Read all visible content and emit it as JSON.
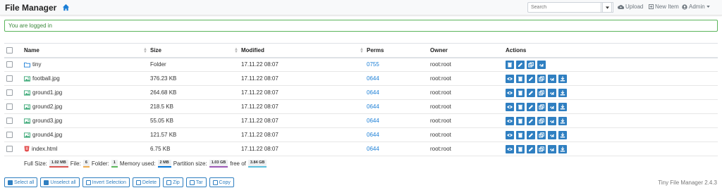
{
  "app": {
    "title": "File Manager",
    "version": "Tiny File Manager 2.4.3"
  },
  "nav": {
    "search_placeholder": "Search",
    "upload": "Upload",
    "new_item": "New Item",
    "admin": "Admin"
  },
  "alert": {
    "message": "You are logged in"
  },
  "table": {
    "headers": {
      "name": "Name",
      "size": "Size",
      "modified": "Modified",
      "perms": "Perms",
      "owner": "Owner",
      "actions": "Actions"
    },
    "rows": [
      {
        "name": "tiny",
        "type": "folder",
        "size": "Folder",
        "modified": "17.11.22 08:07",
        "perms": "0755",
        "owner": "root:root",
        "actions": [
          "delete",
          "rename",
          "copy",
          "link"
        ]
      },
      {
        "name": "football.jpg",
        "type": "image",
        "size": "376.23 KB",
        "modified": "17.11.22 08:07",
        "perms": "0644",
        "owner": "root:root",
        "actions": [
          "view",
          "delete",
          "rename",
          "copy",
          "link",
          "download"
        ]
      },
      {
        "name": "ground1.jpg",
        "type": "image",
        "size": "264.68 KB",
        "modified": "17.11.22 08:07",
        "perms": "0644",
        "owner": "root:root",
        "actions": [
          "view",
          "delete",
          "rename",
          "copy",
          "link",
          "download"
        ]
      },
      {
        "name": "ground2.jpg",
        "type": "image",
        "size": "218.5 KB",
        "modified": "17.11.22 08:07",
        "perms": "0644",
        "owner": "root:root",
        "actions": [
          "view",
          "delete",
          "rename",
          "copy",
          "link",
          "download"
        ]
      },
      {
        "name": "ground3.jpg",
        "type": "image",
        "size": "55.05 KB",
        "modified": "17.11.22 08:07",
        "perms": "0644",
        "owner": "root:root",
        "actions": [
          "view",
          "delete",
          "rename",
          "copy",
          "link",
          "download"
        ]
      },
      {
        "name": "ground4.jpg",
        "type": "image",
        "size": "121.57 KB",
        "modified": "17.11.22 08:07",
        "perms": "0644",
        "owner": "root:root",
        "actions": [
          "view",
          "delete",
          "rename",
          "copy",
          "link",
          "download"
        ]
      },
      {
        "name": "index.html",
        "type": "html",
        "size": "6.75 KB",
        "modified": "17.11.22 08:07",
        "perms": "0644",
        "owner": "root:root",
        "actions": [
          "view",
          "delete",
          "rename",
          "copy",
          "link",
          "download"
        ]
      }
    ]
  },
  "summary": {
    "full_size_label": "Full Size:",
    "full_size": "1.02 MB",
    "file_label": "File:",
    "file_count": "6",
    "folder_label": "Folder:",
    "folder_count": "1",
    "memory_label": "Memory used:",
    "memory": "2 MB",
    "partition_label": "Partition size:",
    "partition": "1.03 GB",
    "free_label": "free of",
    "free": "3.84 GB"
  },
  "buttons": {
    "select_all": "Select all",
    "unselect_all": "Unselect all",
    "invert": "Invert Selection",
    "delete": "Delete",
    "zip": "Zip",
    "tar": "Tar",
    "copy": "Copy"
  },
  "colors": {
    "accent": "#2f7fc1",
    "link": "#1a7ed6",
    "success": "#3c8a3c",
    "badge_full": "#d9534f",
    "badge_file": "#f0ad4e",
    "badge_folder": "#5cb85c",
    "badge_memory": "#0275d8",
    "badge_partition": "#9b59b6",
    "badge_free": "#5bc0de"
  }
}
